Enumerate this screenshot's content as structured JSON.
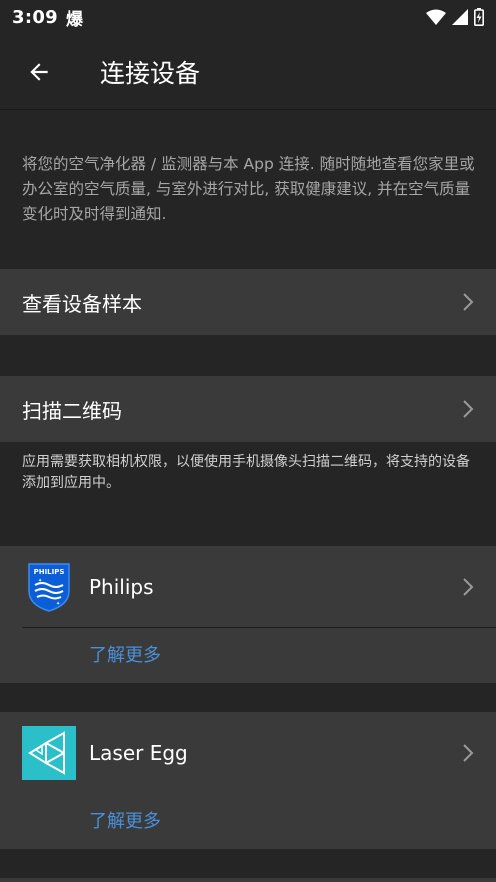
{
  "status_bar": {
    "time": "3:09",
    "extra_glyph": "爆"
  },
  "header": {
    "title": "连接设备",
    "back_icon": "arrow-left-icon"
  },
  "intro_text": "将您的空气净化器 / 监测器与本 App 连接. 随时随地查看您家里或办公室的空气质量, 与室外进行对比, 获取健康建议, 并在空气质量变化时及时得到通知.",
  "rows": {
    "samples": {
      "label": "查看设备样本"
    },
    "scan": {
      "label": "扫描二维码"
    }
  },
  "scan_note": "应用需要获取相机权限，以便使用手机摄像头扫描二维码，将支持的设备添加到应用中。",
  "devices": [
    {
      "name": "Philips",
      "logo_text": "PHILIPS",
      "learn_more": "了解更多"
    },
    {
      "name": "Laser Egg",
      "learn_more": "了解更多"
    }
  ],
  "colors": {
    "background": "#252525",
    "row": "#3a3a3a",
    "link": "#4a90d9",
    "laser_egg": "#2bbfc9",
    "philips": "#0b5ed7"
  }
}
